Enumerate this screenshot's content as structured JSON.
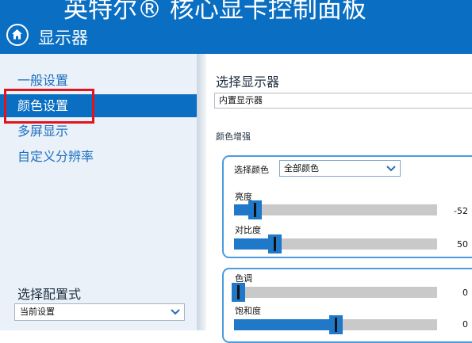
{
  "header": {
    "app_title": "英特尔® 核心显卡控制面板",
    "section_title": "显示器",
    "home_icon": "home-icon"
  },
  "sidebar": {
    "items": [
      {
        "label": "一般设置",
        "active": false
      },
      {
        "label": "颜色设置",
        "active": true
      },
      {
        "label": "多屏显示",
        "active": false
      },
      {
        "label": "自定义分辨率",
        "active": false
      }
    ],
    "preset_label": "选择配置式",
    "preset_value": "当前设置"
  },
  "main": {
    "select_display_label": "选择显示器",
    "display_value": "内置显示器",
    "color_enhance_label": "颜色增强",
    "select_color_label": "选择颜色",
    "color_value": "全部颜色",
    "sliders": [
      {
        "label": "亮度",
        "value": "-52",
        "level": 0.1
      },
      {
        "label": "对比度",
        "value": "50",
        "level": 0.2
      },
      {
        "label": "色调",
        "value": "0",
        "level": 0.02
      },
      {
        "label": "饱和度",
        "value": "0",
        "level": 0.5
      }
    ]
  },
  "colors": {
    "header_bg": "#0a6fc2",
    "active_item": "#0a6fc2",
    "highlight": "#e3131c",
    "slider_fill": "#1f78c8"
  }
}
